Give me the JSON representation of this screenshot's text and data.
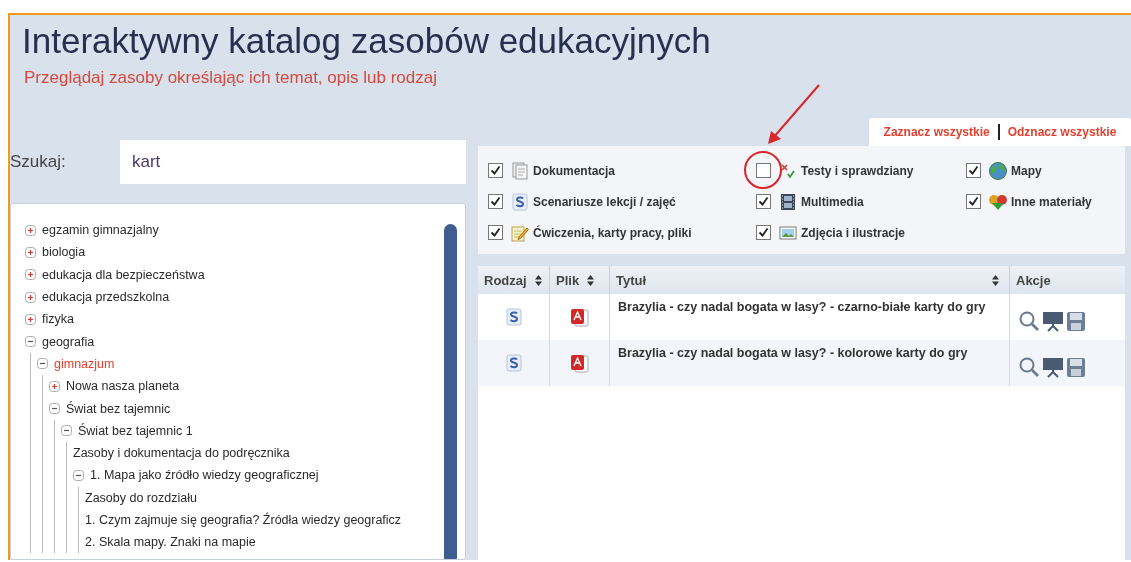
{
  "header": {
    "title": "Interaktywny katalog zasobów edukacyjnych",
    "subtitle": "Przeglądaj zasoby określając ich temat, opis lub rodzaj"
  },
  "search": {
    "label": "Szukaj:",
    "value": "kart"
  },
  "tree": [
    {
      "label": "egzamin gimnazjalny",
      "expanded": false,
      "selected": false
    },
    {
      "label": "biologia",
      "expanded": false,
      "selected": false
    },
    {
      "label": "edukacja dla bezpieczeństwa",
      "expanded": false,
      "selected": false
    },
    {
      "label": "edukacja przedszkolna",
      "expanded": false,
      "selected": false
    },
    {
      "label": "fizyka",
      "expanded": false,
      "selected": false
    },
    {
      "label": "geografia",
      "expanded": true,
      "selected": false,
      "children": [
        {
          "label": "gimnazjum",
          "expanded": true,
          "selected": true,
          "children": [
            {
              "label": "Nowa nasza planeta",
              "expanded": false,
              "selected": false
            },
            {
              "label": "Świat bez tajemnic",
              "expanded": true,
              "selected": false,
              "children": [
                {
                  "label": "Świat bez tajemnic 1",
                  "expanded": true,
                  "selected": false,
                  "children": [
                    {
                      "label": "Zasoby i dokumentacja do podręcznika",
                      "selected": false
                    },
                    {
                      "label": "1. Mapa jako źródło wiedzy geograficznej",
                      "expanded": true,
                      "selected": false,
                      "children": [
                        {
                          "label": "Zasoby do rozdziału",
                          "selected": false
                        },
                        {
                          "label": "1. Czym zajmuje się geografia? Źródła wiedzy geograficz",
                          "selected": false
                        },
                        {
                          "label": "2. Skala mapy. Znaki na mapie",
                          "selected": false
                        }
                      ]
                    }
                  ]
                }
              ]
            }
          ]
        }
      ]
    }
  ],
  "select_links": [
    "Zaznacz wszystkie",
    "Odznacz wszystkie"
  ],
  "filters": [
    {
      "label": "Dokumentacja",
      "kind": "documentation",
      "checked": true,
      "highlighted": false
    },
    {
      "label": "Scenariusze lekcji / zajęć",
      "kind": "scenario",
      "checked": true,
      "highlighted": false
    },
    {
      "label": "Ćwiczenia, karty pracy, pliki",
      "kind": "exercise",
      "checked": true,
      "highlighted": false
    },
    {
      "label": "Testy i sprawdziany",
      "kind": "test",
      "checked": false,
      "highlighted": true
    },
    {
      "label": "Multimedia",
      "kind": "multimedia",
      "checked": true,
      "highlighted": false
    },
    {
      "label": "Zdjęcia i ilustracje",
      "kind": "image",
      "checked": true,
      "highlighted": false
    },
    {
      "label": "Mapy",
      "kind": "map",
      "checked": true,
      "highlighted": false
    },
    {
      "label": "Inne materiały",
      "kind": "other",
      "checked": true,
      "highlighted": false
    }
  ],
  "table": {
    "columns": [
      {
        "label": "Rodzaj",
        "sortable": true
      },
      {
        "label": "Plik",
        "sortable": true
      },
      {
        "label": "Tytuł",
        "sortable": true
      },
      {
        "label": "Akcje",
        "sortable": false
      }
    ],
    "rows": [
      {
        "type": {
          "kind": "scenario"
        },
        "file": {
          "kind": "pdf"
        },
        "title": "Brazylia - czy nadal bogata w lasy? - czarno-białe karty do gry"
      },
      {
        "type": {
          "kind": "scenario"
        },
        "file": {
          "kind": "pdf"
        },
        "title": "Brazylia - czy nadal bogata w lasy? - kolorowe karty do gry"
      }
    ]
  }
}
